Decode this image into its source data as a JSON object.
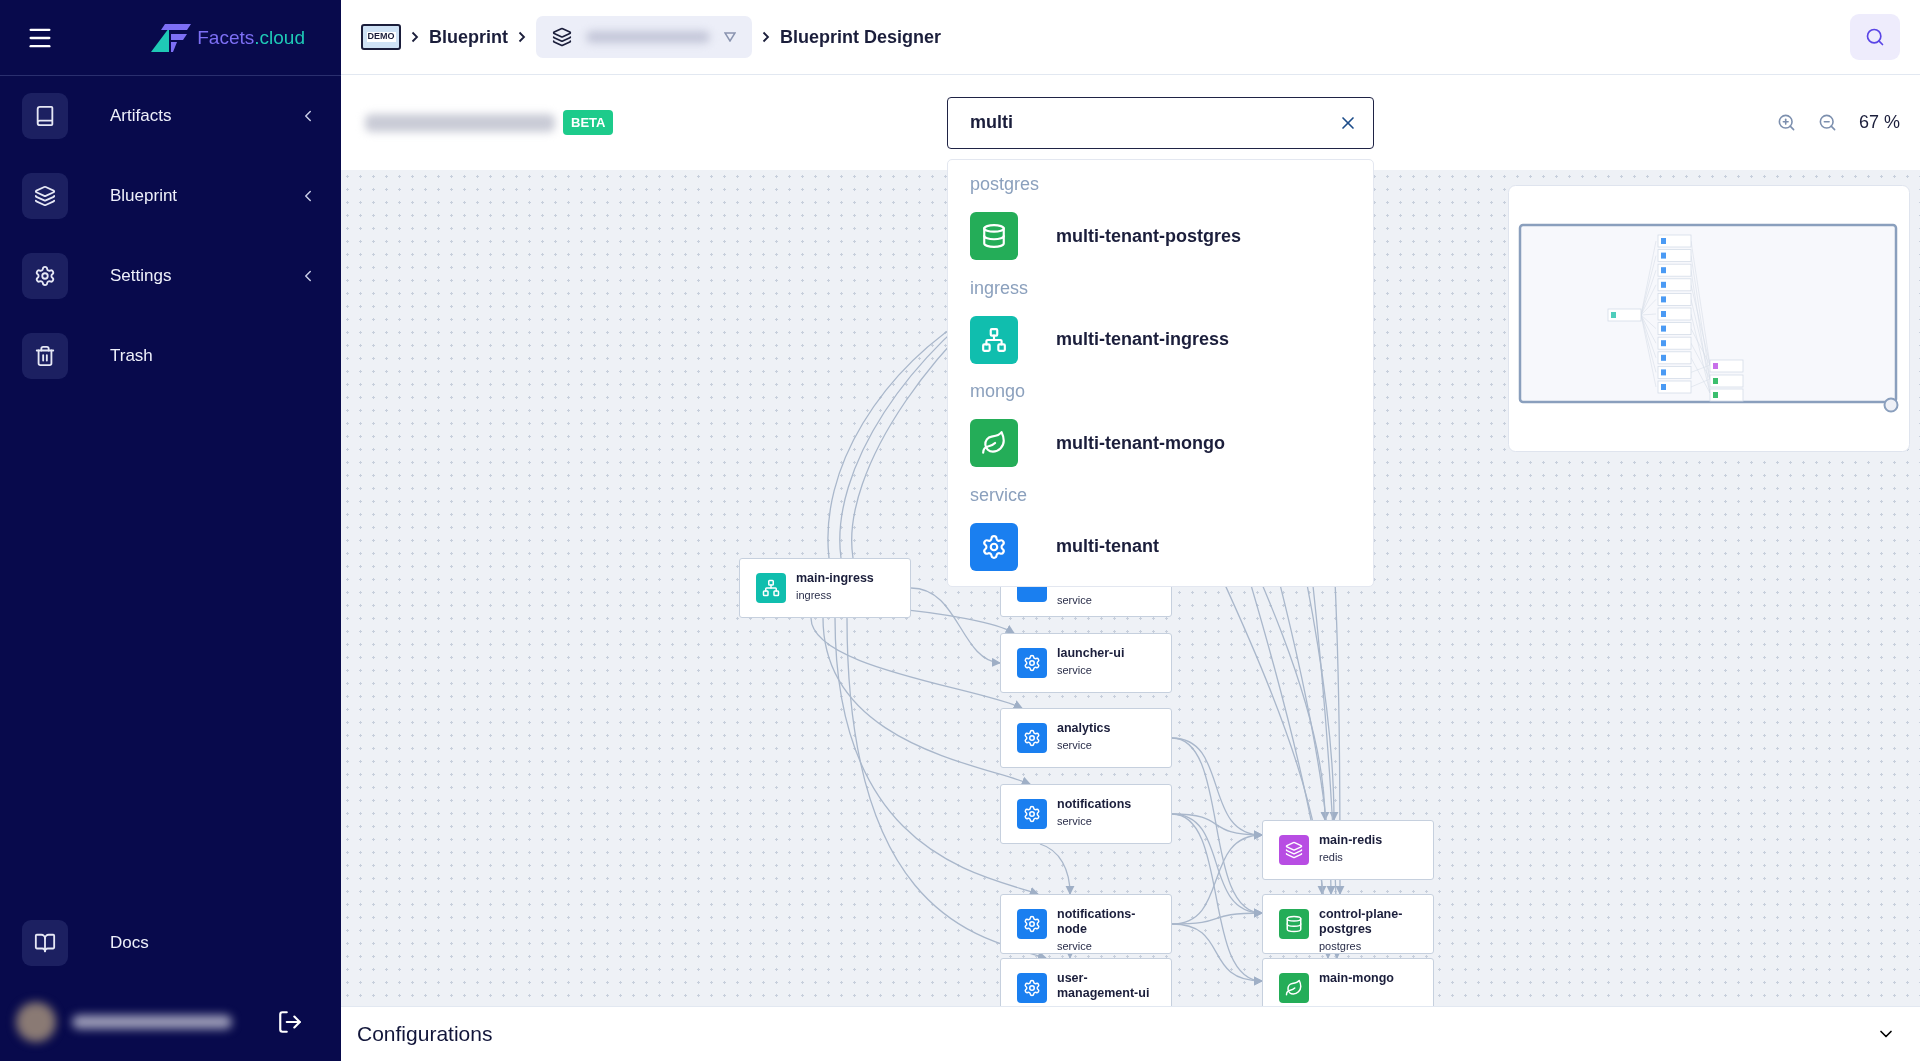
{
  "sidebar": {
    "brand_name": "Facets",
    "brand_domain": ".cloud",
    "items": [
      {
        "label": "Artifacts",
        "kind": "group"
      },
      {
        "label": "Blueprint",
        "kind": "group"
      },
      {
        "label": "Settings",
        "kind": "group"
      },
      {
        "label": "Trash",
        "kind": "link"
      }
    ],
    "footer_items": [
      {
        "label": "Docs"
      }
    ]
  },
  "breadcrumb": {
    "demo_label": "DEMO",
    "items": [
      "Blueprint",
      "Blueprint Designer"
    ]
  },
  "toolbar": {
    "badge": "BETA",
    "search_value": "multi",
    "zoom": "67 %"
  },
  "search_results": [
    {
      "group": "postgres",
      "name": "multi-tenant-postgres",
      "kind": "postgres"
    },
    {
      "group": "ingress",
      "name": "multi-tenant-ingress",
      "kind": "ingress"
    },
    {
      "group": "mongo",
      "name": "multi-tenant-mongo",
      "kind": "mongo"
    },
    {
      "group": "service",
      "name": "multi-tenant",
      "kind": "service"
    }
  ],
  "canvas": {
    "nodes": [
      {
        "name": "main-ingress",
        "type": "ingress",
        "kind": "ingress"
      },
      {
        "type": "service",
        "kind": "service"
      },
      {
        "name": "launcher-ui",
        "type": "service",
        "kind": "service"
      },
      {
        "name": "analytics",
        "type": "service",
        "kind": "service"
      },
      {
        "name": "notifications",
        "type": "service",
        "kind": "service"
      },
      {
        "name": "notifications-node",
        "type": "service",
        "kind": "service"
      },
      {
        "name": "user-management-ui",
        "kind": "service"
      },
      {
        "name": "main-redis",
        "type": "redis",
        "kind": "redis"
      },
      {
        "name": "control-plane-postgres",
        "type": "postgres",
        "kind": "postgres"
      },
      {
        "name": "main-mongo",
        "kind": "mongo"
      }
    ]
  },
  "configurations": {
    "title": "Configurations",
    "expanded": false
  }
}
